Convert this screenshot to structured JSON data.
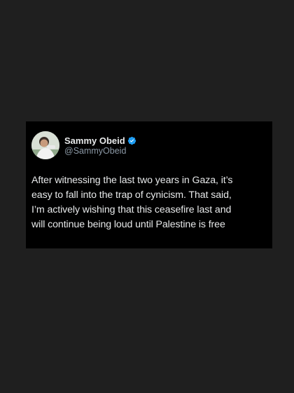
{
  "tweet": {
    "author": {
      "name": "Sammy Obeid",
      "handle": "@SammyObeid",
      "verified": true,
      "avatar_icon": "profile-photo",
      "verified_icon": "verified-badge-icon",
      "verified_color": "#1d9bf0"
    },
    "text_lines": [
      "After witnessing the last two years in Gaza, it’s",
      "easy to fall into the trap of cynicism. That said,",
      "I’m actively wishing that this ceasefire last and",
      "will continue being loud until Palestine is free"
    ]
  },
  "colors": {
    "page_background": "#1f1f1f",
    "card_background": "#000000",
    "text_primary": "#e7e9ea",
    "text_secondary": "#8b98a5"
  }
}
